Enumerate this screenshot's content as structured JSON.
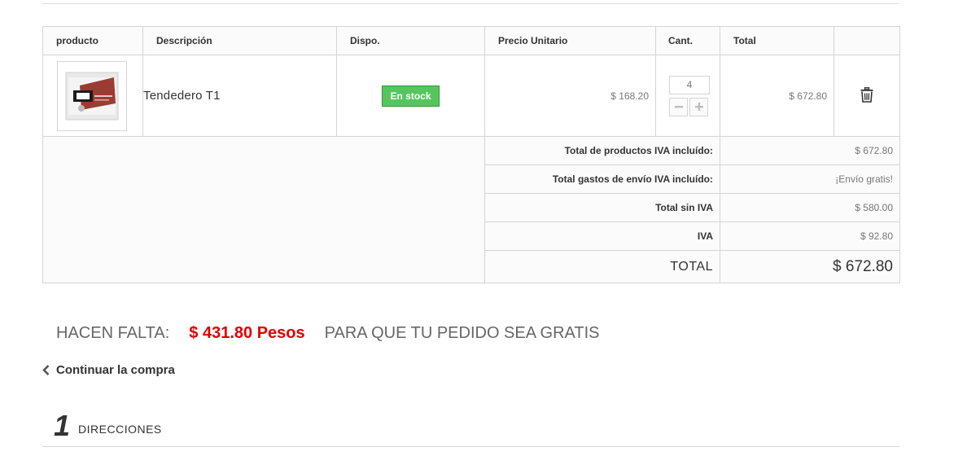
{
  "cart": {
    "headers": {
      "product": "producto",
      "description": "Descripción",
      "availability": "Dispo.",
      "unit_price": "Precio Unitario",
      "quantity": "Cant.",
      "total": "Total"
    },
    "items": [
      {
        "thumbnail_icon": "product-thumbnail",
        "name": "Tendedero T1",
        "availability": "En stock",
        "unit_price": "$ 168.20",
        "quantity": "4",
        "total": "$ 672.80",
        "delete_icon": "trash-icon"
      }
    ],
    "summary": {
      "products_label": "Total de productos IVA incluído:",
      "products_value": "$ 672.80",
      "shipping_label": "Total gastos de envío IVA incluído:",
      "shipping_value": "¡Envío gratis!",
      "subtotal_label": "Total sin IVA",
      "subtotal_value": "$ 580.00",
      "tax_label": "IVA",
      "tax_value": "$ 92.80",
      "total_label": "TOTAL",
      "total_value": "$ 672.80"
    }
  },
  "free_shipping": {
    "prefix": "HACEN FALTA:",
    "amount": "$ 431.80 Pesos",
    "suffix": "PARA QUE TU PEDIDO SEA GRATIS"
  },
  "continue_shopping": {
    "label": "Continuar la compra",
    "icon": "chevron-left-icon"
  },
  "step": {
    "number": "1",
    "title": "DIRECCIONES"
  },
  "colors": {
    "stock_badge": "#55c65e",
    "amount_missing": "#e00000",
    "border": "#d6d4d4"
  }
}
